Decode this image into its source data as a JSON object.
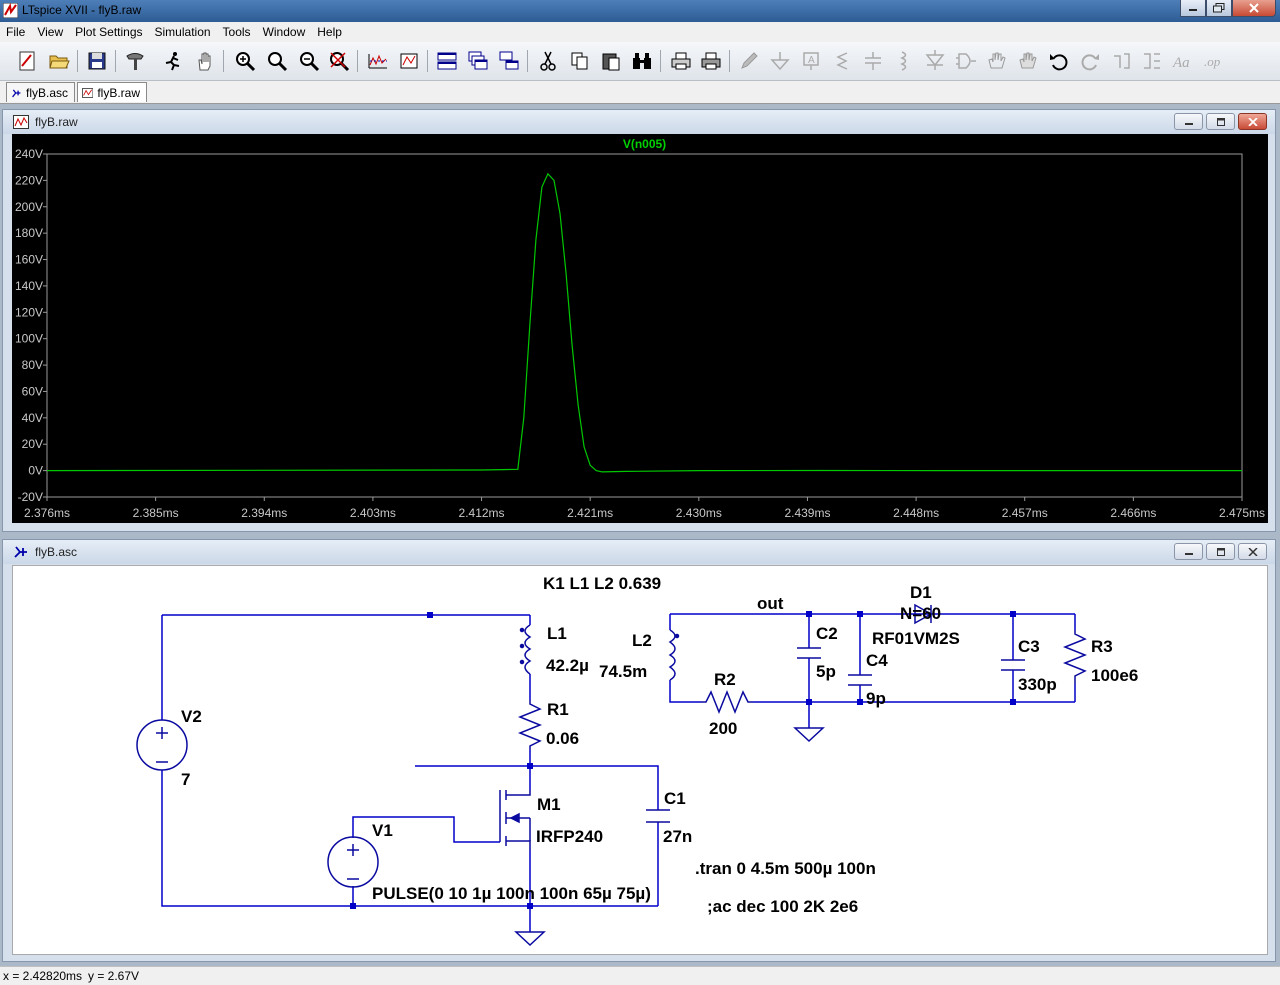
{
  "window": {
    "title": "LTspice XVII - flyB.raw"
  },
  "menu": [
    "File",
    "View",
    "Plot Settings",
    "Simulation",
    "Tools",
    "Window",
    "Help"
  ],
  "tabs": [
    {
      "label": "flyB.asc"
    },
    {
      "label": "flyB.raw"
    }
  ],
  "waveform_window": {
    "title": "flyB.raw"
  },
  "schematic_window": {
    "title": "flyB.asc"
  },
  "colors": {
    "trace": "#00c800",
    "trace_label": "#00d000",
    "plot_bg": "#000000",
    "axis_text": "#c8c8c8",
    "wire": "#0000c8",
    "component": "#0a0aa0"
  },
  "chart_data": {
    "type": "line",
    "series": [
      {
        "name": "V(n005)",
        "x": [
          2.376,
          2.412,
          2.415,
          2.4155,
          2.416,
          2.4165,
          2.417,
          2.4175,
          2.418,
          2.4185,
          2.419,
          2.4195,
          2.42,
          2.4205,
          2.421,
          2.4215,
          2.422,
          2.424,
          2.43,
          2.44,
          2.45,
          2.46,
          2.475
        ],
        "y": [
          0,
          0.5,
          1,
          40,
          110,
          175,
          215,
          225,
          220,
          195,
          150,
          95,
          50,
          18,
          4,
          0,
          -1,
          -0.6,
          0,
          0.1,
          0,
          0,
          0
        ]
      }
    ],
    "xlim": [
      2.376,
      2.475
    ],
    "ylim": [
      -20,
      240
    ],
    "x_ticks": [
      2.376,
      2.385,
      2.394,
      2.403,
      2.412,
      2.421,
      2.43,
      2.439,
      2.448,
      2.457,
      2.466,
      2.475
    ],
    "x_tick_labels": [
      "2.376ms",
      "2.385ms",
      "2.394ms",
      "2.403ms",
      "2.412ms",
      "2.421ms",
      "2.430ms",
      "2.439ms",
      "2.448ms",
      "2.457ms",
      "2.466ms",
      "2.475ms"
    ],
    "y_ticks": [
      -20,
      0,
      20,
      40,
      60,
      80,
      100,
      120,
      140,
      160,
      180,
      200,
      220,
      240
    ],
    "y_tick_labels": [
      "-20V",
      "0V",
      "20V",
      "40V",
      "60V",
      "80V",
      "100V",
      "120V",
      "140V",
      "160V",
      "180V",
      "200V",
      "220V",
      "240V"
    ],
    "grid": false
  },
  "schematic": {
    "coupling": "K1 L1 L2 0.639",
    "net_out": "out",
    "V2": {
      "name": "V2",
      "value": "7"
    },
    "L1": {
      "name": "L1",
      "value": "42.2µ"
    },
    "R1": {
      "name": "R1",
      "value": "0.06"
    },
    "M1": {
      "name": "M1",
      "value": "IRFP240"
    },
    "C1": {
      "name": "C1",
      "value": "27n"
    },
    "V1": {
      "name": "V1",
      "value": "PULSE(0 10 1µ 100n 100n 65µ 75µ)"
    },
    "L2": {
      "name": "L2",
      "value": "74.5m"
    },
    "R2": {
      "name": "R2",
      "value": "200"
    },
    "C2": {
      "name": "C2",
      "value": "5p"
    },
    "C4": {
      "name": "C4",
      "value": "9p"
    },
    "D1": {
      "name": "D1",
      "param": "N=60",
      "value": "RF01VM2S"
    },
    "C3": {
      "name": "C3",
      "value": "330p"
    },
    "R3": {
      "name": "R3",
      "value": "100e6"
    },
    "directive_tran": ".tran 0 4.5m 500µ 100n",
    "directive_ac": ";ac dec 100 2K 2e6"
  },
  "status": {
    "x": "x = 2.42820ms",
    "y": "y = 2.67V"
  }
}
